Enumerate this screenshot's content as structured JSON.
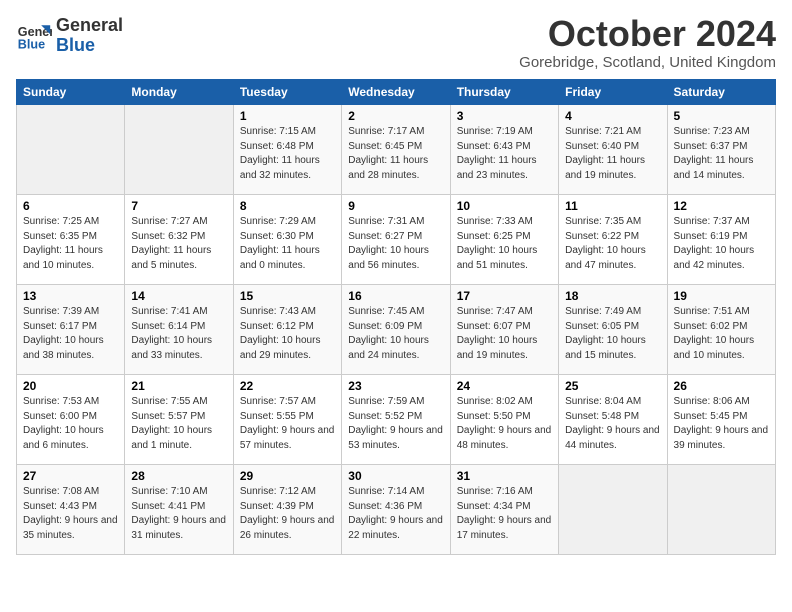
{
  "header": {
    "logo_general": "General",
    "logo_blue": "Blue",
    "month": "October 2024",
    "location": "Gorebridge, Scotland, United Kingdom"
  },
  "days_of_week": [
    "Sunday",
    "Monday",
    "Tuesday",
    "Wednesday",
    "Thursday",
    "Friday",
    "Saturday"
  ],
  "weeks": [
    [
      {
        "day": "",
        "info": ""
      },
      {
        "day": "",
        "info": ""
      },
      {
        "day": "1",
        "info": "Sunrise: 7:15 AM\nSunset: 6:48 PM\nDaylight: 11 hours and 32 minutes."
      },
      {
        "day": "2",
        "info": "Sunrise: 7:17 AM\nSunset: 6:45 PM\nDaylight: 11 hours and 28 minutes."
      },
      {
        "day": "3",
        "info": "Sunrise: 7:19 AM\nSunset: 6:43 PM\nDaylight: 11 hours and 23 minutes."
      },
      {
        "day": "4",
        "info": "Sunrise: 7:21 AM\nSunset: 6:40 PM\nDaylight: 11 hours and 19 minutes."
      },
      {
        "day": "5",
        "info": "Sunrise: 7:23 AM\nSunset: 6:37 PM\nDaylight: 11 hours and 14 minutes."
      }
    ],
    [
      {
        "day": "6",
        "info": "Sunrise: 7:25 AM\nSunset: 6:35 PM\nDaylight: 11 hours and 10 minutes."
      },
      {
        "day": "7",
        "info": "Sunrise: 7:27 AM\nSunset: 6:32 PM\nDaylight: 11 hours and 5 minutes."
      },
      {
        "day": "8",
        "info": "Sunrise: 7:29 AM\nSunset: 6:30 PM\nDaylight: 11 hours and 0 minutes."
      },
      {
        "day": "9",
        "info": "Sunrise: 7:31 AM\nSunset: 6:27 PM\nDaylight: 10 hours and 56 minutes."
      },
      {
        "day": "10",
        "info": "Sunrise: 7:33 AM\nSunset: 6:25 PM\nDaylight: 10 hours and 51 minutes."
      },
      {
        "day": "11",
        "info": "Sunrise: 7:35 AM\nSunset: 6:22 PM\nDaylight: 10 hours and 47 minutes."
      },
      {
        "day": "12",
        "info": "Sunrise: 7:37 AM\nSunset: 6:19 PM\nDaylight: 10 hours and 42 minutes."
      }
    ],
    [
      {
        "day": "13",
        "info": "Sunrise: 7:39 AM\nSunset: 6:17 PM\nDaylight: 10 hours and 38 minutes."
      },
      {
        "day": "14",
        "info": "Sunrise: 7:41 AM\nSunset: 6:14 PM\nDaylight: 10 hours and 33 minutes."
      },
      {
        "day": "15",
        "info": "Sunrise: 7:43 AM\nSunset: 6:12 PM\nDaylight: 10 hours and 29 minutes."
      },
      {
        "day": "16",
        "info": "Sunrise: 7:45 AM\nSunset: 6:09 PM\nDaylight: 10 hours and 24 minutes."
      },
      {
        "day": "17",
        "info": "Sunrise: 7:47 AM\nSunset: 6:07 PM\nDaylight: 10 hours and 19 minutes."
      },
      {
        "day": "18",
        "info": "Sunrise: 7:49 AM\nSunset: 6:05 PM\nDaylight: 10 hours and 15 minutes."
      },
      {
        "day": "19",
        "info": "Sunrise: 7:51 AM\nSunset: 6:02 PM\nDaylight: 10 hours and 10 minutes."
      }
    ],
    [
      {
        "day": "20",
        "info": "Sunrise: 7:53 AM\nSunset: 6:00 PM\nDaylight: 10 hours and 6 minutes."
      },
      {
        "day": "21",
        "info": "Sunrise: 7:55 AM\nSunset: 5:57 PM\nDaylight: 10 hours and 1 minute."
      },
      {
        "day": "22",
        "info": "Sunrise: 7:57 AM\nSunset: 5:55 PM\nDaylight: 9 hours and 57 minutes."
      },
      {
        "day": "23",
        "info": "Sunrise: 7:59 AM\nSunset: 5:52 PM\nDaylight: 9 hours and 53 minutes."
      },
      {
        "day": "24",
        "info": "Sunrise: 8:02 AM\nSunset: 5:50 PM\nDaylight: 9 hours and 48 minutes."
      },
      {
        "day": "25",
        "info": "Sunrise: 8:04 AM\nSunset: 5:48 PM\nDaylight: 9 hours and 44 minutes."
      },
      {
        "day": "26",
        "info": "Sunrise: 8:06 AM\nSunset: 5:45 PM\nDaylight: 9 hours and 39 minutes."
      }
    ],
    [
      {
        "day": "27",
        "info": "Sunrise: 7:08 AM\nSunset: 4:43 PM\nDaylight: 9 hours and 35 minutes."
      },
      {
        "day": "28",
        "info": "Sunrise: 7:10 AM\nSunset: 4:41 PM\nDaylight: 9 hours and 31 minutes."
      },
      {
        "day": "29",
        "info": "Sunrise: 7:12 AM\nSunset: 4:39 PM\nDaylight: 9 hours and 26 minutes."
      },
      {
        "day": "30",
        "info": "Sunrise: 7:14 AM\nSunset: 4:36 PM\nDaylight: 9 hours and 22 minutes."
      },
      {
        "day": "31",
        "info": "Sunrise: 7:16 AM\nSunset: 4:34 PM\nDaylight: 9 hours and 17 minutes."
      },
      {
        "day": "",
        "info": ""
      },
      {
        "day": "",
        "info": ""
      }
    ]
  ]
}
